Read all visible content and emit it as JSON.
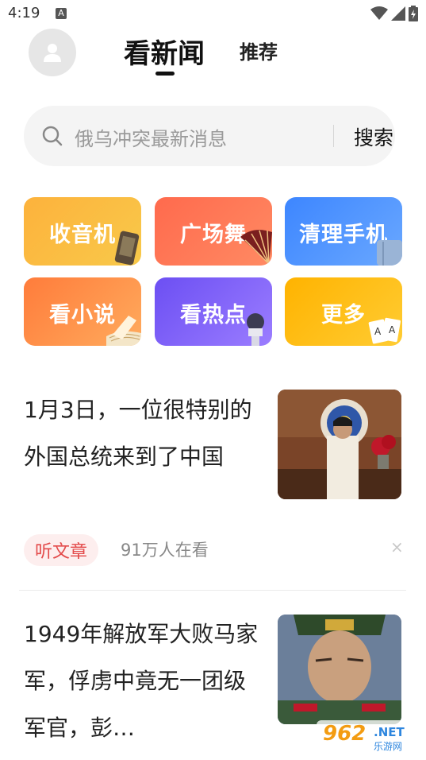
{
  "status_bar": {
    "time": "4:19",
    "notification_icon_letter": "A",
    "icons": [
      "wifi-icon",
      "signal-icon",
      "battery-icon"
    ]
  },
  "header": {
    "avatar_icon": "user-icon",
    "tabs": [
      {
        "label": "看新闻",
        "active": true
      },
      {
        "label": "推荐",
        "active": false
      }
    ]
  },
  "search": {
    "placeholder": "俄乌冲突最新消息",
    "button_label": "搜索",
    "icon": "search-icon"
  },
  "categories": [
    {
      "label": "收音机",
      "icon": "phone-icon",
      "gradient": [
        "#fdb23c",
        "#f8c94a"
      ]
    },
    {
      "label": "广场舞",
      "icon": "fan-icon",
      "gradient": [
        "#ff6a4d",
        "#ff8a63"
      ]
    },
    {
      "label": "清理手机",
      "icon": "jeans-icon",
      "gradient": [
        "#3d86ff",
        "#6aa8ff"
      ]
    },
    {
      "label": "看小说",
      "icon": "book-icon",
      "gradient": [
        "#ff7c3b",
        "#ffab5d"
      ]
    },
    {
      "label": "看热点",
      "icon": "microphone-icon",
      "gradient": [
        "#6c4ff3",
        "#9b7dff"
      ]
    },
    {
      "label": "更多",
      "icon": "playing-cards-icon",
      "gradient": [
        "#ffb300",
        "#ffcc33"
      ]
    }
  ],
  "news": [
    {
      "title": "1月3日，一位很特别的外国总统来到了中国",
      "tag": "听文章",
      "views": "91万人在看",
      "close": "×",
      "thumbnail": "president-photo"
    },
    {
      "title": "1949年解放军大败马家军，俘虏中竟无一团级军官，彭…",
      "thumbnail": "general-portrait"
    }
  ],
  "watermark": {
    "brand": "962",
    "suffix": ".NET",
    "subtitle": "乐游网"
  },
  "colors": {
    "tag_text": "#e34a4a",
    "tag_bg": "#fdeeee",
    "search_bg": "#f4f4f4"
  }
}
